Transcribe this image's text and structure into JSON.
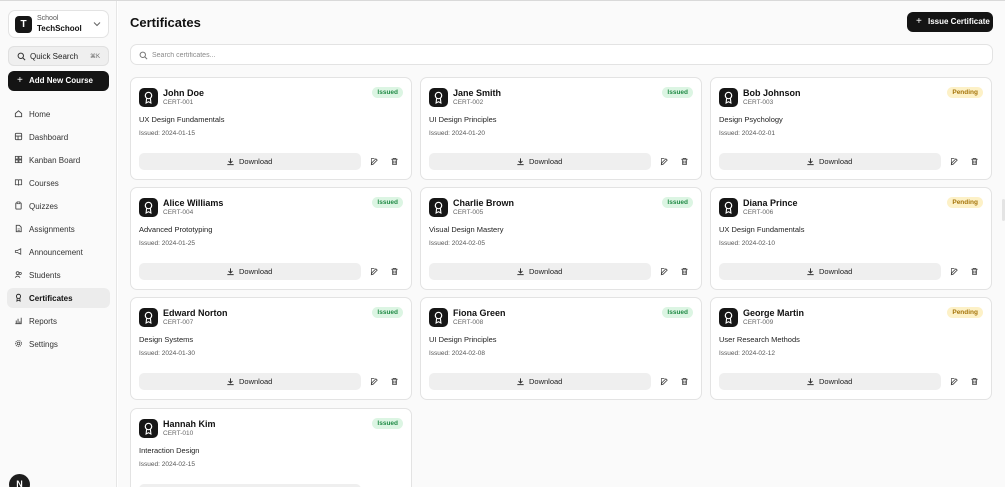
{
  "sidebar": {
    "school_label": "School",
    "school_name": "TechSchool",
    "school_initial": "T",
    "quick_search": "Quick Search",
    "quick_search_shortcut": "⌘K",
    "add_course": "Add New Course",
    "items": [
      {
        "label": "Home",
        "icon": "home-icon"
      },
      {
        "label": "Dashboard",
        "icon": "dashboard-icon"
      },
      {
        "label": "Kanban Board",
        "icon": "kanban-icon"
      },
      {
        "label": "Courses",
        "icon": "book-icon"
      },
      {
        "label": "Quizzes",
        "icon": "clipboard-icon"
      },
      {
        "label": "Assignments",
        "icon": "file-icon"
      },
      {
        "label": "Announcement",
        "icon": "megaphone-icon"
      },
      {
        "label": "Students",
        "icon": "users-icon"
      },
      {
        "label": "Certificates",
        "icon": "award-icon",
        "active": true
      },
      {
        "label": "Reports",
        "icon": "bar-chart-icon"
      },
      {
        "label": "Settings",
        "icon": "gear-icon"
      }
    ],
    "avatar_initial": "N"
  },
  "main": {
    "title": "Certificates",
    "issue_button": "Issue Certificate",
    "search_placeholder": "Search certificates...",
    "download_label": "Download",
    "certificates": [
      {
        "name": "John Doe",
        "id": "CERT-001",
        "status": "Issued",
        "course": "UX Design Fundamentals",
        "issued": "Issued: 2024-01-15"
      },
      {
        "name": "Jane Smith",
        "id": "CERT-002",
        "status": "Issued",
        "course": "UI Design Principles",
        "issued": "Issued: 2024-01-20"
      },
      {
        "name": "Bob Johnson",
        "id": "CERT-003",
        "status": "Pending",
        "course": "Design Psychology",
        "issued": "Issued: 2024-02-01"
      },
      {
        "name": "Alice Williams",
        "id": "CERT-004",
        "status": "Issued",
        "course": "Advanced Prototyping",
        "issued": "Issued: 2024-01-25"
      },
      {
        "name": "Charlie Brown",
        "id": "CERT-005",
        "status": "Issued",
        "course": "Visual Design Mastery",
        "issued": "Issued: 2024-02-05"
      },
      {
        "name": "Diana Prince",
        "id": "CERT-006",
        "status": "Pending",
        "course": "UX Design Fundamentals",
        "issued": "Issued: 2024-02-10"
      },
      {
        "name": "Edward Norton",
        "id": "CERT-007",
        "status": "Issued",
        "course": "Design Systems",
        "issued": "Issued: 2024-01-30"
      },
      {
        "name": "Fiona Green",
        "id": "CERT-008",
        "status": "Issued",
        "course": "UI Design Principles",
        "issued": "Issued: 2024-02-08"
      },
      {
        "name": "George Martin",
        "id": "CERT-009",
        "status": "Pending",
        "course": "User Research Methods",
        "issued": "Issued: 2024-02-12"
      },
      {
        "name": "Hannah Kim",
        "id": "CERT-010",
        "status": "Issued",
        "course": "Interaction Design",
        "issued": "Issued: 2024-02-15"
      }
    ]
  },
  "colors": {
    "primary": "#141414",
    "issued_bg": "#dcf5e3",
    "issued_text": "#1f8a45",
    "pending_bg": "#fdf1c7",
    "pending_text": "#a5740a"
  }
}
